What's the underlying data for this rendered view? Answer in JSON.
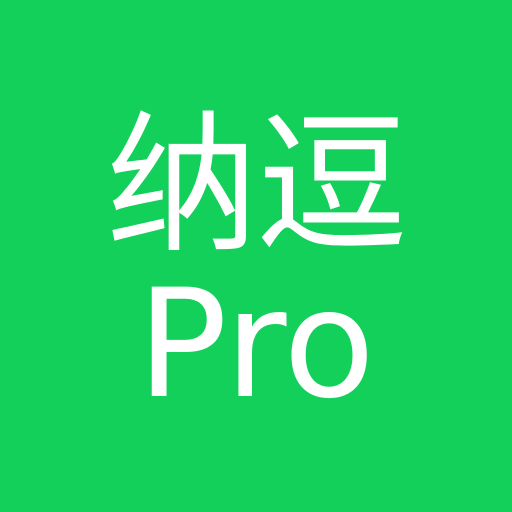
{
  "icon": {
    "background_color": "#12d05a",
    "text_color": "#ffffff",
    "title_line1": "纳逗",
    "title_line2": "Pro"
  }
}
